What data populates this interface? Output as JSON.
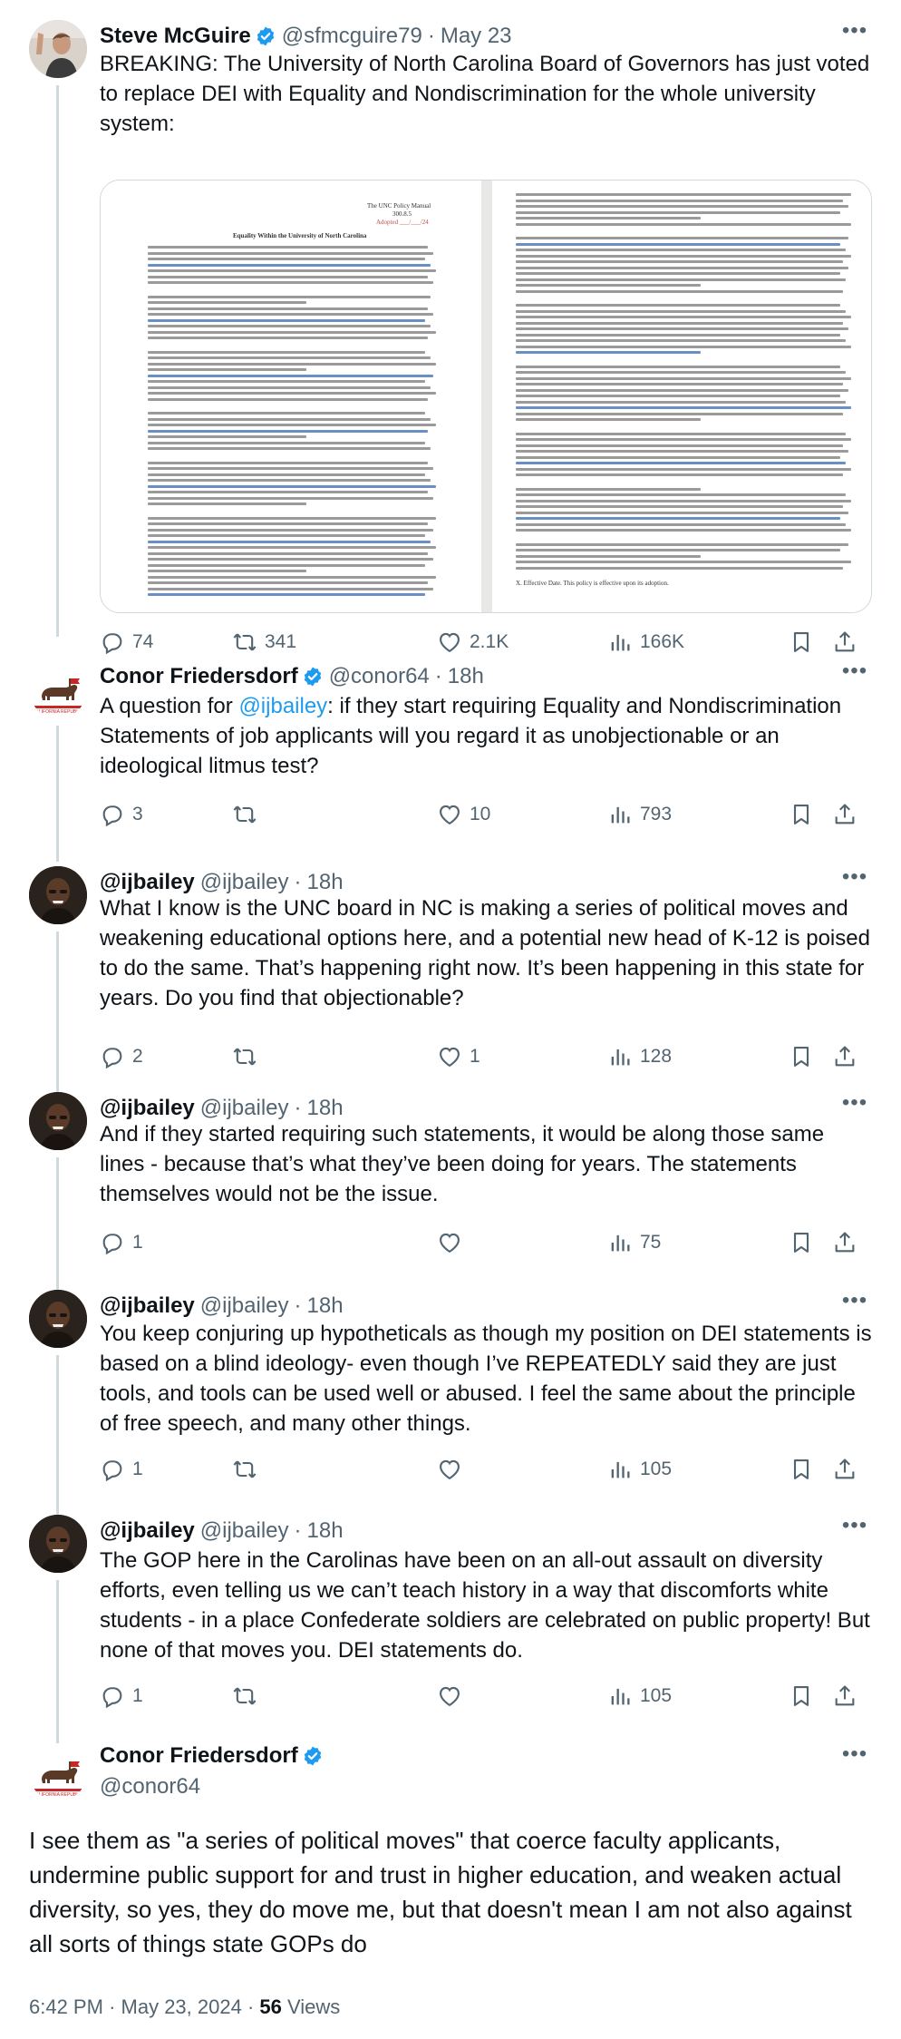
{
  "tweets": [
    {
      "name": "Steve McGuire",
      "handle": "@sfmcguire79",
      "time": "May 23",
      "text": "BREAKING: The University of North Carolina Board of Governors has just voted to replace DEI with Equality and Nondiscrimination for the whole university system:",
      "replies": "74",
      "retweets": "341",
      "likes": "2.1K",
      "views": "166K",
      "media": {
        "left_header": "The UNC Policy Manual",
        "left_number": "300.8.5",
        "left_adopted": "Adopted ___/___/24",
        "left_title": "Equality Within the University of North Carolina",
        "right_last_line": "X.     Effective Date. This policy is effective upon its adoption."
      }
    },
    {
      "name": "Conor Friedersdorf",
      "handle": "@conor64",
      "time": "18h",
      "text_before": "A question for ",
      "mention": "@ijbailey",
      "text_after": ": if they start requiring Equality and Nondiscrimination Statements of job applicants will you regard it as unobjectionable or an ideological litmus test?",
      "replies": "3",
      "retweets": "",
      "likes": "10",
      "views": "793"
    },
    {
      "name": "@ijbailey",
      "handle": "@ijbailey",
      "time": "18h",
      "text": "What I know is the UNC board in NC is making a series of political moves and weakening educational options here, and a potential new head of K-12 is poised to do the same. That’s happening right now. It’s been happening in this state for years. Do you find that objectionable?",
      "replies": "2",
      "retweets": "",
      "likes": "1",
      "views": "128"
    },
    {
      "name": "@ijbailey",
      "handle": "@ijbailey",
      "time": "18h",
      "text": "And if they started requiring such statements, it would be along those same lines - because that’s what they’ve been doing for years. The statements themselves would not be the issue.",
      "replies": "1",
      "likes": "",
      "views": "75"
    },
    {
      "name": "@ijbailey",
      "handle": "@ijbailey",
      "time": "18h",
      "text": "You keep conjuring up hypotheticals as though my position on DEI statements is based on a blind ideology- even though I’ve REPEATEDLY said they are just tools, and tools can be used well or abused. I feel the same about the principle of free speech, and many other things.",
      "replies": "1",
      "retweets": "",
      "likes": "",
      "views": "105"
    },
    {
      "name": "@ijbailey",
      "handle": "@ijbailey",
      "time": "18h",
      "text": "The GOP here in the Carolinas have been on an all-out assault on diversity efforts, even telling us we can’t teach history in a way that discomforts white students - in a place Confederate soldiers are celebrated on public property! But none of that moves you. DEI statements do.",
      "replies": "1",
      "retweets": "",
      "likes": "",
      "views": "105"
    }
  ],
  "main_tweet": {
    "name": "Conor Friedersdorf",
    "handle": "@conor64",
    "text": "I see them as \"a series of political moves\" that coerce faculty applicants, undermine public support for and trust in higher education, and weaken actual diversity, so yes, they do move me, but that doesn't mean I am not also against all sorts of things state GOPs do",
    "time": "6:42 PM",
    "date": "May 23, 2024",
    "views_count": "56",
    "views_label": "Views"
  },
  "colors": {
    "verified": "#1d9bf0",
    "mention": "#1d9bf0",
    "secondary_text": "#536471",
    "thread_line": "#cfd9de"
  },
  "icons": [
    "reply-icon",
    "retweet-icon",
    "like-icon",
    "views-icon",
    "bookmark-icon",
    "share-icon",
    "more-icon",
    "verified-icon"
  ]
}
